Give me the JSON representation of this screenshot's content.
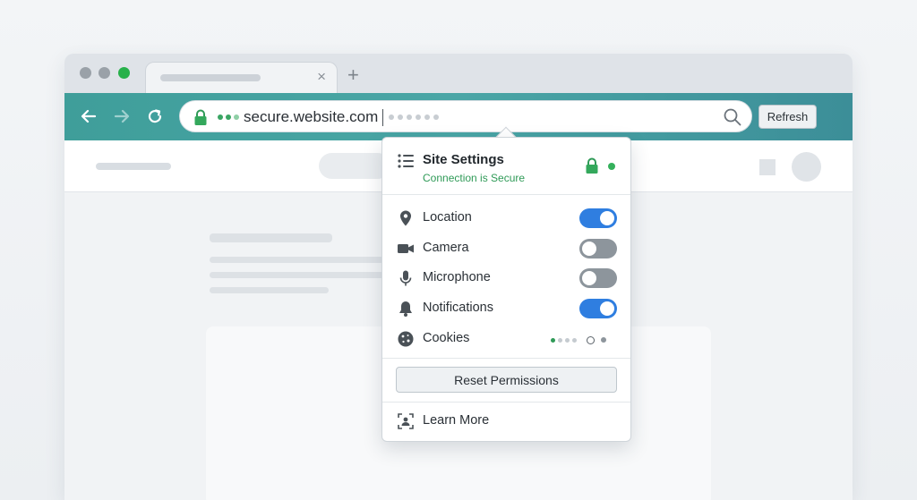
{
  "browser": {
    "tab": {
      "close_glyph": "×"
    },
    "new_tab_glyph": "+",
    "address": {
      "url": "secure.website.com",
      "lock_icon": "lock-icon",
      "search_icon": "search-icon"
    },
    "refresh_label": "Refresh"
  },
  "popup": {
    "title": "Site Settings",
    "subtitle": "Connection is Secure",
    "permissions": [
      {
        "label": "Location",
        "icon": "location-pin-icon",
        "state": "on"
      },
      {
        "label": "Camera",
        "icon": "camera-icon",
        "state": "off"
      },
      {
        "label": "Microphone",
        "icon": "microphone-icon",
        "state": "off"
      },
      {
        "label": "Notifications",
        "icon": "bell-icon",
        "state": "on"
      },
      {
        "label": "Cookies",
        "icon": "cookie-icon",
        "state": "indicator"
      }
    ],
    "reset_label": "Reset Permissions",
    "learn_more_label": "Learn More"
  },
  "colors": {
    "accent_teal": "#46a3a2",
    "secure_green": "#2f9a57",
    "toggle_on": "#2f7ee0",
    "toggle_off": "#8d959c"
  }
}
